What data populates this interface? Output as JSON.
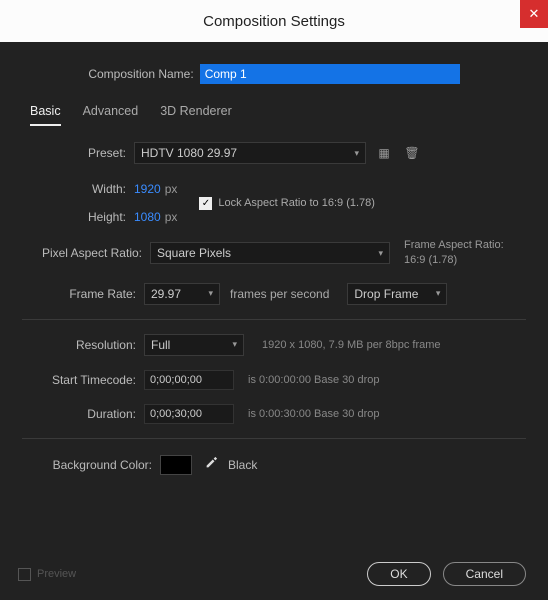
{
  "title": "Composition Settings",
  "name_field": {
    "label": "Composition Name:",
    "value": "Comp 1"
  },
  "tabs": {
    "basic": "Basic",
    "advanced": "Advanced",
    "renderer": "3D Renderer"
  },
  "preset": {
    "label": "Preset:",
    "value": "HDTV 1080 29.97"
  },
  "width": {
    "label": "Width:",
    "value": "1920",
    "unit": "px"
  },
  "height": {
    "label": "Height:",
    "value": "1080",
    "unit": "px"
  },
  "lock_aspect": {
    "label": "Lock Aspect Ratio to 16:9 (1.78)"
  },
  "pixel_aspect": {
    "label": "Pixel Aspect Ratio:",
    "value": "Square Pixels"
  },
  "frame_aspect": {
    "line1": "Frame Aspect Ratio:",
    "line2": "16:9 (1.78)"
  },
  "frame_rate": {
    "label": "Frame Rate:",
    "value": "29.97",
    "mid": "frames per second",
    "drop": "Drop Frame"
  },
  "resolution": {
    "label": "Resolution:",
    "value": "Full",
    "info": "1920 x 1080, 7.9 MB per 8bpc frame"
  },
  "start_tc": {
    "label": "Start Timecode:",
    "value": "0;00;00;00",
    "info": "is 0:00:00:00  Base 30  drop"
  },
  "duration": {
    "label": "Duration:",
    "value": "0;00;30;00",
    "info": "is 0:00:30:00  Base 30  drop"
  },
  "bg": {
    "label": "Background Color:",
    "name": "Black",
    "hex": "#000000"
  },
  "footer": {
    "preview": "Preview",
    "ok": "OK",
    "cancel": "Cancel"
  }
}
